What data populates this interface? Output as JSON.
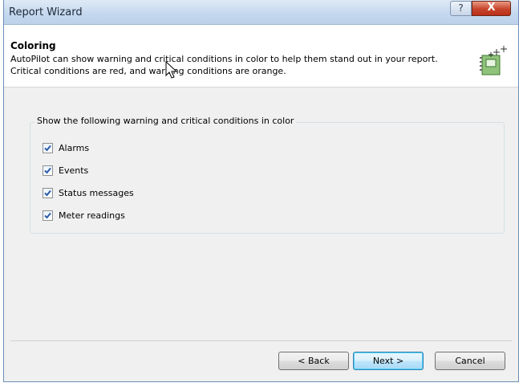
{
  "window": {
    "title": "Report Wizard",
    "help_glyph": "?",
    "close_glyph": "X"
  },
  "header": {
    "title": "Coloring",
    "description_line1": "AutoPilot can show warning and critical conditions in color to help them stand out in your report.",
    "description_line2": "Critical conditions are red, and warning conditions are orange.",
    "icon": "wizard-sparkle-icon"
  },
  "group": {
    "legend": "Show the following warning and critical conditions in color",
    "items": [
      {
        "label": "Alarms",
        "checked": true
      },
      {
        "label": "Events",
        "checked": true
      },
      {
        "label": "Status messages",
        "checked": true
      },
      {
        "label": "Meter readings",
        "checked": true
      }
    ]
  },
  "footer": {
    "back_label": "< Back",
    "next_label": "Next >",
    "cancel_label": "Cancel"
  },
  "colors": {
    "accent": "#3c7fb1",
    "check_mark": "#2a5aa8",
    "close_button": "#c7442b"
  }
}
